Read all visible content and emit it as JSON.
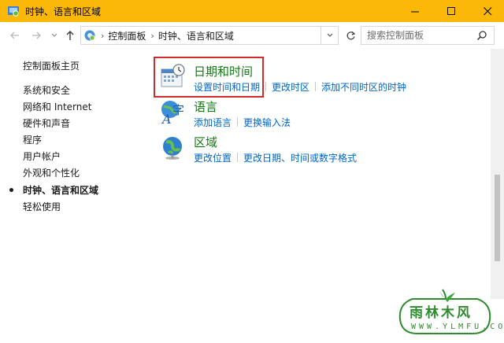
{
  "window": {
    "title": "时钟、语言和区域",
    "titlebar_color": "#fbb809",
    "icons": {
      "app": "control-panel-icon",
      "minimize": "minimize-icon",
      "maximize": "maximize-icon",
      "close": "close-icon"
    }
  },
  "nav": {
    "back_icon": "arrow-left-icon",
    "forward_icon": "arrow-right-icon",
    "recent_icon": "chevron-down-icon",
    "up_icon": "arrow-up-icon",
    "breadcrumb": [
      "控制面板",
      "时钟、语言和区域"
    ],
    "refresh_icon": "refresh-icon",
    "search_placeholder": "搜索控制面板",
    "search_icon": "search-icon"
  },
  "sidebar": {
    "home": "控制面板主页",
    "items": [
      {
        "label": "系统和安全",
        "active": false
      },
      {
        "label": "网络和 Internet",
        "active": false
      },
      {
        "label": "硬件和声音",
        "active": false
      },
      {
        "label": "程序",
        "active": false
      },
      {
        "label": "用户帐户",
        "active": false
      },
      {
        "label": "外观和个性化",
        "active": false
      },
      {
        "label": "时钟、语言和区域",
        "active": true
      },
      {
        "label": "轻松使用",
        "active": false
      }
    ]
  },
  "categories": [
    {
      "title": "日期和时间",
      "icon": "calendar-clock-icon",
      "links": [
        "设置时间和日期",
        "更改时区",
        "添加不同时区的时钟"
      ],
      "highlighted": true
    },
    {
      "title": "语言",
      "icon": "language-icon",
      "links": [
        "添加语言",
        "更换输入法"
      ],
      "highlighted": false
    },
    {
      "title": "区域",
      "icon": "globe-icon",
      "links": [
        "更改位置",
        "更改日期、时间或数字格式"
      ],
      "highlighted": false
    }
  ],
  "colors": {
    "category_title": "#127a12",
    "link": "#0066cc",
    "highlight_box": "#d22b2b"
  },
  "watermark": {
    "text": "雨林木风",
    "url": "WWW.YLMFU.COM"
  }
}
